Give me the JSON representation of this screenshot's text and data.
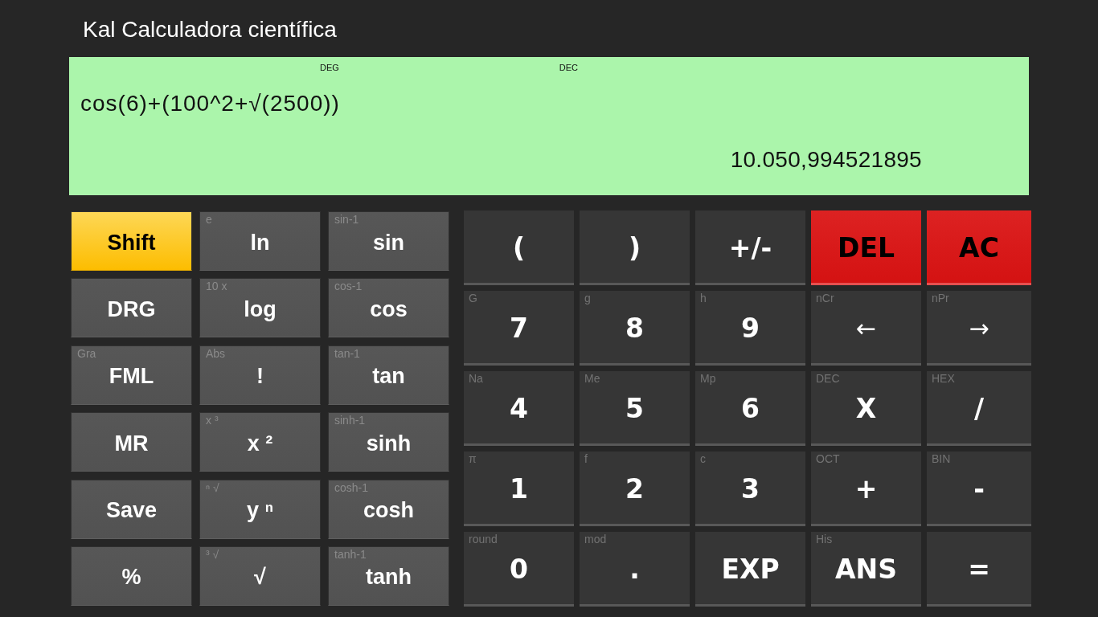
{
  "title": "Kal Calculadora científica",
  "display": {
    "indicators": [
      "DEG",
      "DEC"
    ],
    "expression": "cos(6)+(100^2+√(2500))",
    "result": "10.050,994521895"
  },
  "function_keys": [
    {
      "label": "Shift",
      "kind": "shift"
    },
    {
      "label": "ln",
      "secondary": "e",
      "kind": "function"
    },
    {
      "label": "sin",
      "secondary": "sin-1",
      "kind": "function"
    },
    {
      "label": "DRG",
      "kind": "function"
    },
    {
      "label": "log",
      "secondary": "10 x",
      "kind": "function"
    },
    {
      "label": "cos",
      "secondary": "cos-1",
      "kind": "function"
    },
    {
      "label": "FML",
      "secondary": "Gra",
      "kind": "function"
    },
    {
      "label": "!",
      "secondary": "Abs",
      "kind": "function"
    },
    {
      "label": "tan",
      "secondary": "tan-1",
      "kind": "function"
    },
    {
      "label": "MR",
      "kind": "function"
    },
    {
      "label": "x ²",
      "secondary": "x ³",
      "kind": "function"
    },
    {
      "label": "sinh",
      "secondary": "sinh-1",
      "kind": "function"
    },
    {
      "label": "Save",
      "kind": "function"
    },
    {
      "label": "y ⁿ",
      "secondary": "ⁿ √",
      "kind": "function"
    },
    {
      "label": "cosh",
      "secondary": "cosh-1",
      "kind": "function"
    },
    {
      "label": "%",
      "kind": "function"
    },
    {
      "label": "√",
      "secondary": "³ √",
      "kind": "function"
    },
    {
      "label": "tanh",
      "secondary": "tanh-1",
      "kind": "function"
    }
  ],
  "keypad": [
    {
      "label": "(",
      "kind": "key"
    },
    {
      "label": ")",
      "kind": "key"
    },
    {
      "label": "+/-",
      "kind": "key"
    },
    {
      "label": "DEL",
      "kind": "clear"
    },
    {
      "label": "AC",
      "kind": "clear"
    },
    {
      "label": "7",
      "secondary": "G",
      "kind": "key"
    },
    {
      "label": "8",
      "secondary": "g",
      "kind": "key"
    },
    {
      "label": "9",
      "secondary": "h",
      "kind": "key"
    },
    {
      "label": "←",
      "secondary": "nCr",
      "kind": "arrow"
    },
    {
      "label": "→",
      "secondary": "nPr",
      "kind": "arrow"
    },
    {
      "label": "4",
      "secondary": "Na",
      "kind": "key"
    },
    {
      "label": "5",
      "secondary": "Me",
      "kind": "key"
    },
    {
      "label": "6",
      "secondary": "Mp",
      "kind": "key"
    },
    {
      "label": "X",
      "secondary": "DEC",
      "kind": "key"
    },
    {
      "label": "/",
      "secondary": "HEX",
      "kind": "key"
    },
    {
      "label": "1",
      "secondary": "π",
      "kind": "key"
    },
    {
      "label": "2",
      "secondary": "f",
      "kind": "key"
    },
    {
      "label": "3",
      "secondary": "c",
      "kind": "key"
    },
    {
      "label": "+",
      "secondary": "OCT",
      "kind": "key"
    },
    {
      "label": "-",
      "secondary": "BIN",
      "kind": "key"
    },
    {
      "label": "0",
      "secondary": "round",
      "kind": "key"
    },
    {
      "label": ".",
      "secondary": "mod",
      "kind": "key"
    },
    {
      "label": "EXP",
      "kind": "key"
    },
    {
      "label": "ANS",
      "secondary": "His",
      "kind": "key"
    },
    {
      "label": "=",
      "kind": "key"
    }
  ]
}
